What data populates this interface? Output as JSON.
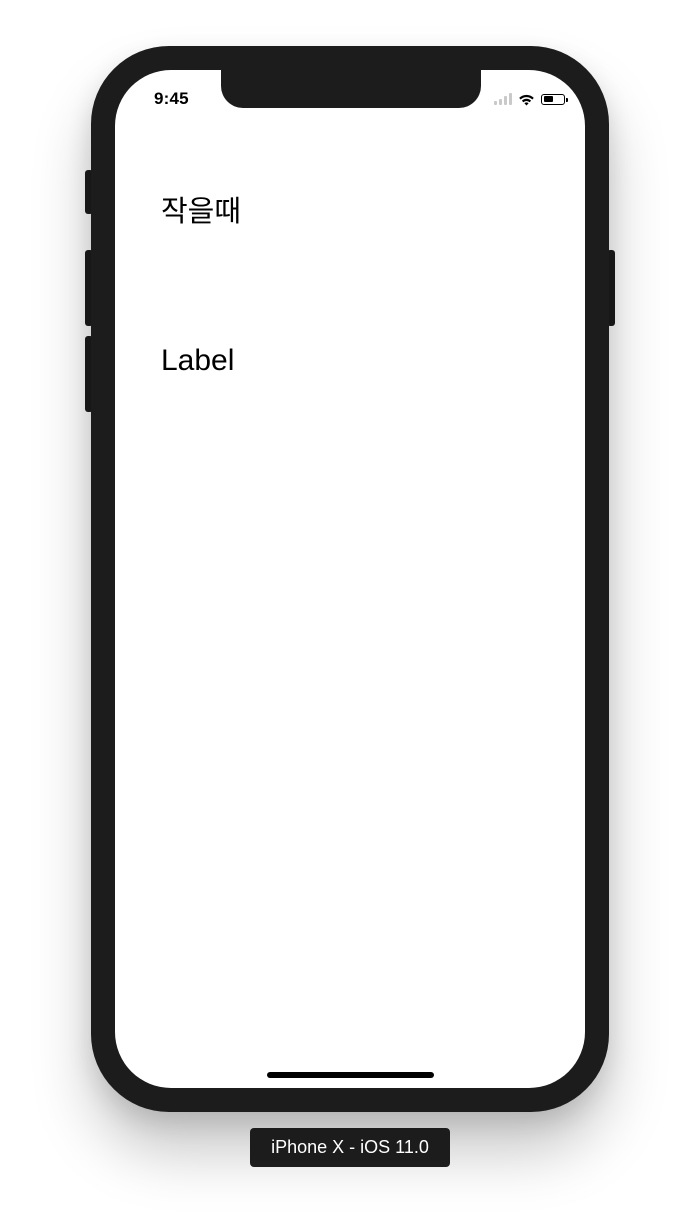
{
  "status_bar": {
    "time": "9:45",
    "battery_level": 0.5
  },
  "content": {
    "label_1": "작을때",
    "label_2": "Label"
  },
  "device_caption": "iPhone X - iOS 11.0"
}
